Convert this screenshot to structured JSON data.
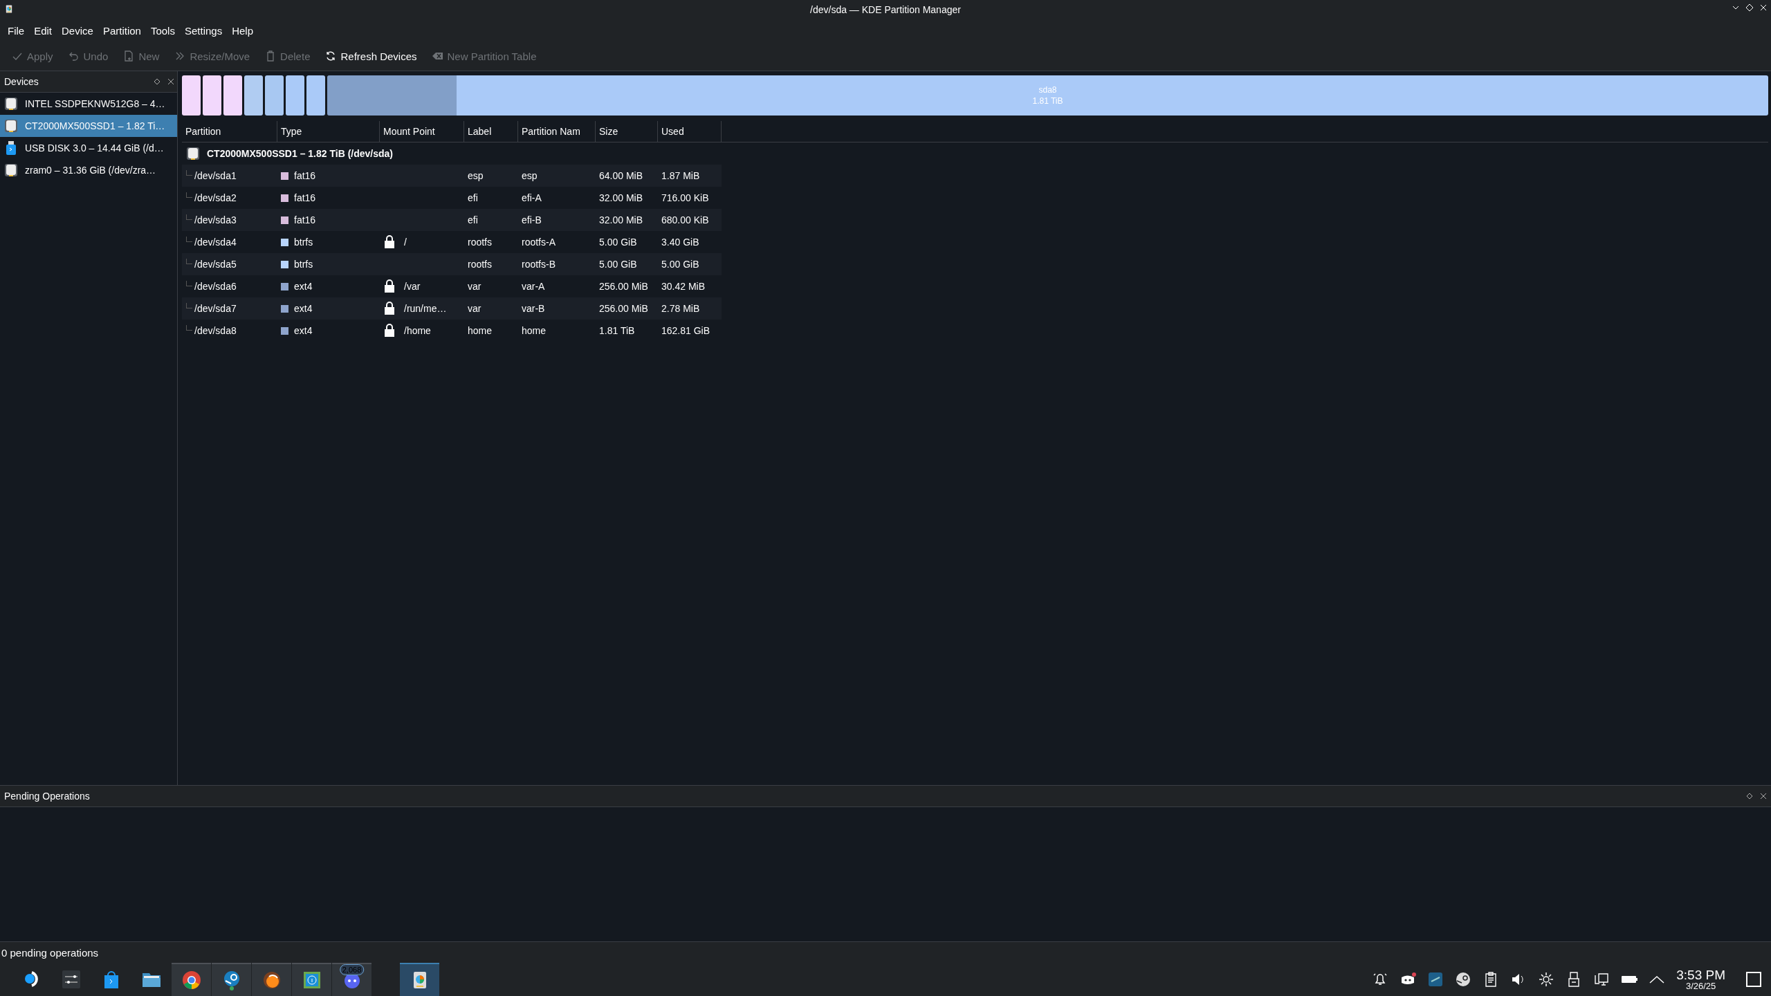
{
  "window": {
    "title": "/dev/sda — KDE Partition Manager"
  },
  "menu": [
    "File",
    "Edit",
    "Device",
    "Partition",
    "Tools",
    "Settings",
    "Help"
  ],
  "toolbar": [
    {
      "label": "Apply",
      "kind": "check",
      "disabled": true
    },
    {
      "label": "Undo",
      "kind": "undo",
      "disabled": true
    },
    {
      "label": "New",
      "kind": "new",
      "disabled": true
    },
    {
      "label": "Resize/Move",
      "kind": "resize",
      "disabled": true
    },
    {
      "label": "Delete",
      "kind": "delete",
      "disabled": true
    },
    {
      "label": "Refresh Devices",
      "kind": "refresh",
      "disabled": false
    },
    {
      "label": "New Partition Table",
      "kind": "table",
      "disabled": true
    }
  ],
  "devices_panel": {
    "title": "Devices",
    "items": [
      {
        "label": "INTEL SSDPEKNW512G8 – 4…",
        "kind": "drive",
        "selected": false
      },
      {
        "label": "CT2000MX500SSD1 – 1.82 Ti…",
        "kind": "drive",
        "selected": true
      },
      {
        "label": "USB DISK 3.0 – 14.44 GiB (/d…",
        "kind": "usb",
        "selected": false
      },
      {
        "label": "zram0 – 31.36 GiB (/dev/zra…",
        "kind": "drive",
        "selected": false
      }
    ]
  },
  "partition_bar": {
    "segments": [
      {
        "color": "#f2d8fc"
      },
      {
        "color": "#f2d8fc"
      },
      {
        "color": "#f2d8fc"
      },
      {
        "color": "#b0ccf2"
      },
      {
        "color": "#a8c8f2"
      },
      {
        "color": "#aacaf8"
      },
      {
        "color": "#aacaf8"
      },
      {
        "color": "#aacaf8",
        "level": 0.09,
        "label": "sda8",
        "size": "1.81 TiB"
      }
    ]
  },
  "table": {
    "columns": [
      "Partition",
      "Type",
      "Mount Point",
      "Label",
      "Partition Nam",
      "Size",
      "Used"
    ],
    "device_row": "CT2000MX500SSD1 – 1.82 TiB (/dev/sda)",
    "rows": [
      {
        "partition": "/dev/sda1",
        "type": "fat16",
        "color": "#d8bcdc",
        "mounted": false,
        "label": "esp",
        "partition_name": "esp",
        "size": "64.00 MiB",
        "used": "1.87 MiB"
      },
      {
        "partition": "/dev/sda2",
        "type": "fat16",
        "color": "#d8bcdc",
        "mounted": false,
        "label": "efi",
        "partition_name": "efi-A",
        "size": "32.00 MiB",
        "used": "716.00 KiB"
      },
      {
        "partition": "/dev/sda3",
        "type": "fat16",
        "color": "#d8bcdc",
        "mounted": false,
        "label": "efi",
        "partition_name": "efi-B",
        "size": "32.00 MiB",
        "used": "680.00 KiB"
      },
      {
        "partition": "/dev/sda4",
        "type": "btrfs",
        "color": "#b8d4fc",
        "mounted": true,
        "mount_point": "/",
        "label": "rootfs",
        "partition_name": "rootfs-A",
        "size": "5.00 GiB",
        "used": "3.40 GiB"
      },
      {
        "partition": "/dev/sda5",
        "type": "btrfs",
        "color": "#b8d4fc",
        "mounted": false,
        "label": "rootfs",
        "partition_name": "rootfs-B",
        "size": "5.00 GiB",
        "used": "5.00 GiB"
      },
      {
        "partition": "/dev/sda6",
        "type": "ext4",
        "color": "#8ea4cc",
        "mounted": true,
        "mount_point": "/var",
        "label": "var",
        "partition_name": "var-A",
        "size": "256.00 MiB",
        "used": "30.42 MiB"
      },
      {
        "partition": "/dev/sda7",
        "type": "ext4",
        "color": "#8ea4cc",
        "mounted": true,
        "mount_point": "/run/me…",
        "label": "var",
        "partition_name": "var-B",
        "size": "256.00 MiB",
        "used": "2.78 MiB"
      },
      {
        "partition": "/dev/sda8",
        "type": "ext4",
        "color": "#8ea4cc",
        "mounted": true,
        "mount_point": "/home",
        "label": "home",
        "partition_name": "home",
        "size": "1.81 TiB",
        "used": "162.81 GiB"
      }
    ]
  },
  "pending": {
    "title": "Pending Operations"
  },
  "status_bar": "0 pending operations",
  "taskbar": {
    "apps": [
      {
        "kind": "launcher",
        "running": false,
        "selected": false
      },
      {
        "kind": "settings",
        "running": false,
        "selected": false
      },
      {
        "kind": "store",
        "running": false,
        "selected": false
      },
      {
        "kind": "files",
        "running": false,
        "selected": false
      },
      {
        "kind": "chrome",
        "running": true,
        "selected": false
      },
      {
        "kind": "steam",
        "running": true,
        "selected": false
      },
      {
        "kind": "orange",
        "running": true,
        "selected": false
      },
      {
        "kind": "info",
        "running": true,
        "selected": false
      },
      {
        "kind": "discord",
        "running": true,
        "selected": false,
        "badge": "2,068"
      },
      {
        "kind": "partitionmanager",
        "running": true,
        "selected": true
      }
    ],
    "tray": [
      {
        "kind": "bell"
      },
      {
        "kind": "discord"
      },
      {
        "kind": "rsi"
      },
      {
        "kind": "steam"
      },
      {
        "kind": "clipboard"
      },
      {
        "kind": "volume"
      },
      {
        "kind": "brightness"
      },
      {
        "kind": "usb"
      },
      {
        "kind": "network"
      },
      {
        "kind": "battery"
      },
      {
        "kind": "arrow"
      }
    ],
    "clock": {
      "time": "3:53 PM",
      "date": "3/26/25"
    }
  }
}
